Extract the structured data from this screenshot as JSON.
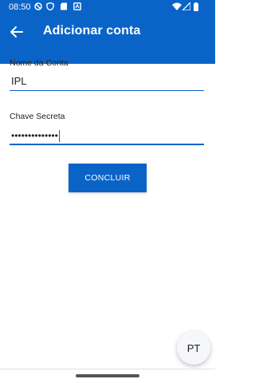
{
  "status_bar": {
    "time": "08:50"
  },
  "toolbar": {
    "title": "Adicionar conta"
  },
  "form": {
    "account_name": {
      "label": "Nome da Conta",
      "value": "IPL"
    },
    "secret_key": {
      "label": "Chave Secreta",
      "value": "••••••••••••••"
    },
    "submit_label": "CONCLUIR"
  },
  "language_button": {
    "label": "PT"
  },
  "colors": {
    "primary": "#0a64c8",
    "background": "#ffffff",
    "input_line": "#0a64c8"
  }
}
